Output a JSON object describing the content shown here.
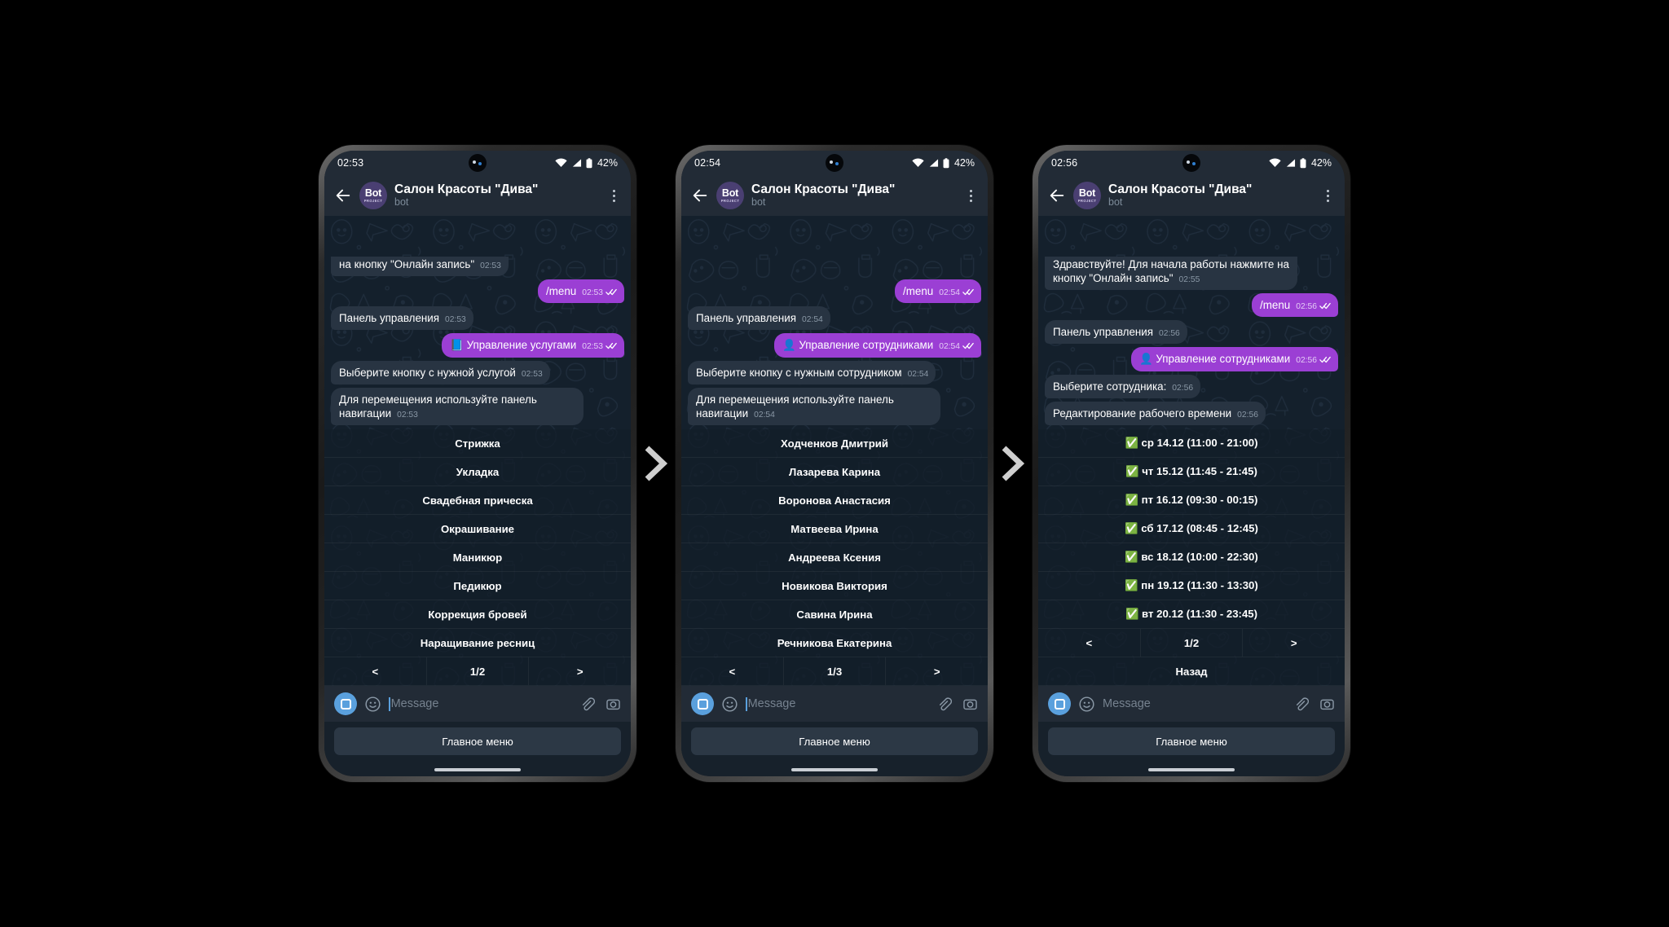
{
  "common": {
    "header": {
      "title": "Салон Красоты \"Дива\"",
      "subtitle": "bot",
      "avatar_line1": "Bot",
      "avatar_line2": "PROJECT"
    },
    "input": {
      "placeholder": "Message",
      "main_menu_label": "Главное меню"
    },
    "status": {
      "battery_pct": "42%"
    },
    "colors": {
      "outgoing_bubble": "#9b3fd4",
      "incoming_bubble": "#283442",
      "chat_background": "#14202c",
      "header_background": "#222b36",
      "accent_blue": "#5aa0dd",
      "check_green": "#46c06a"
    }
  },
  "phones": [
    {
      "status_time": "02:53",
      "messages": [
        {
          "dir": "in",
          "text": "на кнопку \"Онлайн запись\"",
          "time": "02:53",
          "clipped": true
        },
        {
          "dir": "out",
          "text": "/menu",
          "time": "02:53",
          "ticks": true
        },
        {
          "dir": "in",
          "text": "Панель управления",
          "time": "02:53"
        },
        {
          "dir": "out",
          "text": "📘 Управление услугами",
          "time": "02:53",
          "ticks": true
        },
        {
          "dir": "in",
          "text": "Выберите кнопку с нужной услугой",
          "time": "02:53"
        },
        {
          "dir": "in",
          "text": "Для перемещения используйте панель навигации",
          "time": "02:53"
        }
      ],
      "keyboard": {
        "buttons": [
          "Стрижка",
          "Укладка",
          "Свадебная прическа",
          "Окрашивание",
          "Маникюр",
          "Педикюр",
          "Коррекция бровей",
          "Наращивание ресниц"
        ],
        "nav": {
          "prev": "<",
          "page": "1/2",
          "next": ">"
        },
        "extra": []
      }
    },
    {
      "status_time": "02:54",
      "messages": [
        {
          "dir": "out",
          "text": "/menu",
          "time": "02:54",
          "ticks": true
        },
        {
          "dir": "in",
          "text": "Панель управления",
          "time": "02:54"
        },
        {
          "dir": "out",
          "text": "👤 Управление сотрудниками",
          "time": "02:54",
          "ticks": true
        },
        {
          "dir": "in",
          "text": "Выберите кнопку с нужным сотрудником",
          "time": "02:54"
        },
        {
          "dir": "in",
          "text": "Для перемещения используйте панель навигации",
          "time": "02:54"
        }
      ],
      "keyboard": {
        "buttons": [
          "Ходченков Дмитрий",
          "Лазарева Карина",
          "Воронова Анастасия",
          "Матвеева Ирина",
          "Андреева Ксения",
          "Новикова Виктория",
          "Савина Ирина",
          "Речникова Екатерина"
        ],
        "nav": {
          "prev": "<",
          "page": "1/3",
          "next": ">"
        },
        "extra": []
      }
    },
    {
      "status_time": "02:56",
      "messages": [
        {
          "dir": "in",
          "text": "Здравствуйте! Для начала работы нажмите на кнопку \"Онлайн запись\"",
          "time": "02:55",
          "clipped": true
        },
        {
          "dir": "out",
          "text": "/menu",
          "time": "02:56",
          "ticks": true
        },
        {
          "dir": "in",
          "text": "Панель управления",
          "time": "02:56"
        },
        {
          "dir": "out",
          "text": "👤 Управление сотрудниками",
          "time": "02:56",
          "ticks": true
        },
        {
          "dir": "in",
          "text": "Выберите сотрудника:",
          "time": "02:56"
        },
        {
          "dir": "in",
          "text": "Редактирование рабочего времени",
          "time": "02:56"
        }
      ],
      "keyboard": {
        "buttons": [
          "✅ ср 14.12 (11:00 - 21:00)",
          "✅ чт 15.12 (11:45 - 21:45)",
          "✅ пт 16.12 (09:30 - 00:15)",
          "✅ сб 17.12 (08:45 - 12:45)",
          "✅ вс 18.12 (10:00 - 22:30)",
          "✅ пн 19.12 (11:30 - 13:30)",
          "✅ вт 20.12 (11:30 - 23:45)"
        ],
        "nav": {
          "prev": "<",
          "page": "1/2",
          "next": ">"
        },
        "extra": [
          "Назад"
        ]
      }
    }
  ]
}
